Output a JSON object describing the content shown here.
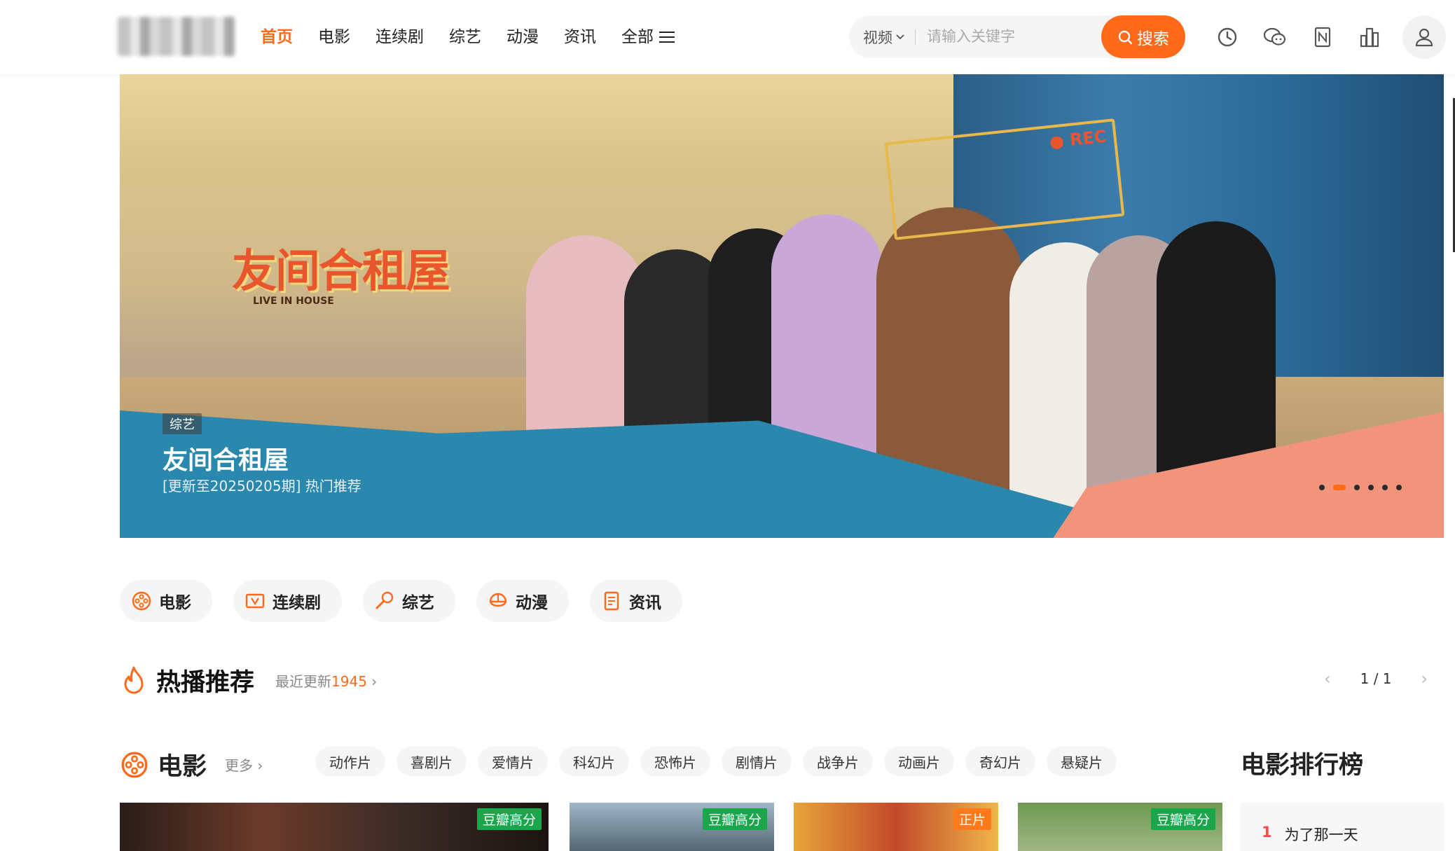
{
  "header": {
    "nav": [
      {
        "label": "首页",
        "active": true
      },
      {
        "label": "电影"
      },
      {
        "label": "连续剧"
      },
      {
        "label": "综艺"
      },
      {
        "label": "动漫"
      },
      {
        "label": "资讯"
      }
    ],
    "all_label": "全部",
    "search": {
      "category": "视频",
      "placeholder": "请输入关键字",
      "button": "搜索"
    },
    "icons": [
      "history-icon",
      "wechat-icon",
      "bookmark-icon",
      "ranking-icon",
      "user-icon"
    ]
  },
  "banner": {
    "tag": "综艺",
    "title": "友间合租屋",
    "subtitle": "[更新至20250205期] 热门推荐",
    "logo_text": "友间合租屋",
    "logo_sub": "LIVE IN HOUSE",
    "rec_label": "● REC",
    "slide_count": 6,
    "active_slide": 2
  },
  "categories": [
    {
      "label": "电影",
      "icon": "film-reel-icon"
    },
    {
      "label": "连续剧",
      "icon": "tv-icon"
    },
    {
      "label": "综艺",
      "icon": "microphone-icon"
    },
    {
      "label": "动漫",
      "icon": "anime-icon"
    },
    {
      "label": "资讯",
      "icon": "news-icon"
    }
  ],
  "hot": {
    "title": "热播推荐",
    "recent_prefix": "最近更新",
    "recent_count": "1945",
    "page": "1 / 1"
  },
  "movies": {
    "title": "电影",
    "more": "更多",
    "genres": [
      "动作片",
      "喜剧片",
      "爱情片",
      "科幻片",
      "恐怖片",
      "剧情片",
      "战争片",
      "动画片",
      "奇幻片",
      "悬疑片"
    ],
    "posters": [
      {
        "badge": "豆瓣高分",
        "badge_color": "#1aa64a"
      },
      {
        "badge": "豆瓣高分",
        "badge_color": "#1aa64a"
      },
      {
        "badge": "正片",
        "badge_color": "#ff7a1a"
      },
      {
        "badge": "豆瓣高分",
        "badge_color": "#1aa64a"
      }
    ],
    "ranking_title": "电影排行榜",
    "ranking": [
      {
        "rank": "1",
        "title": "为了那一天"
      }
    ]
  },
  "colors": {
    "accent": "#ff6a1a",
    "badge_green": "#1aa64a"
  }
}
